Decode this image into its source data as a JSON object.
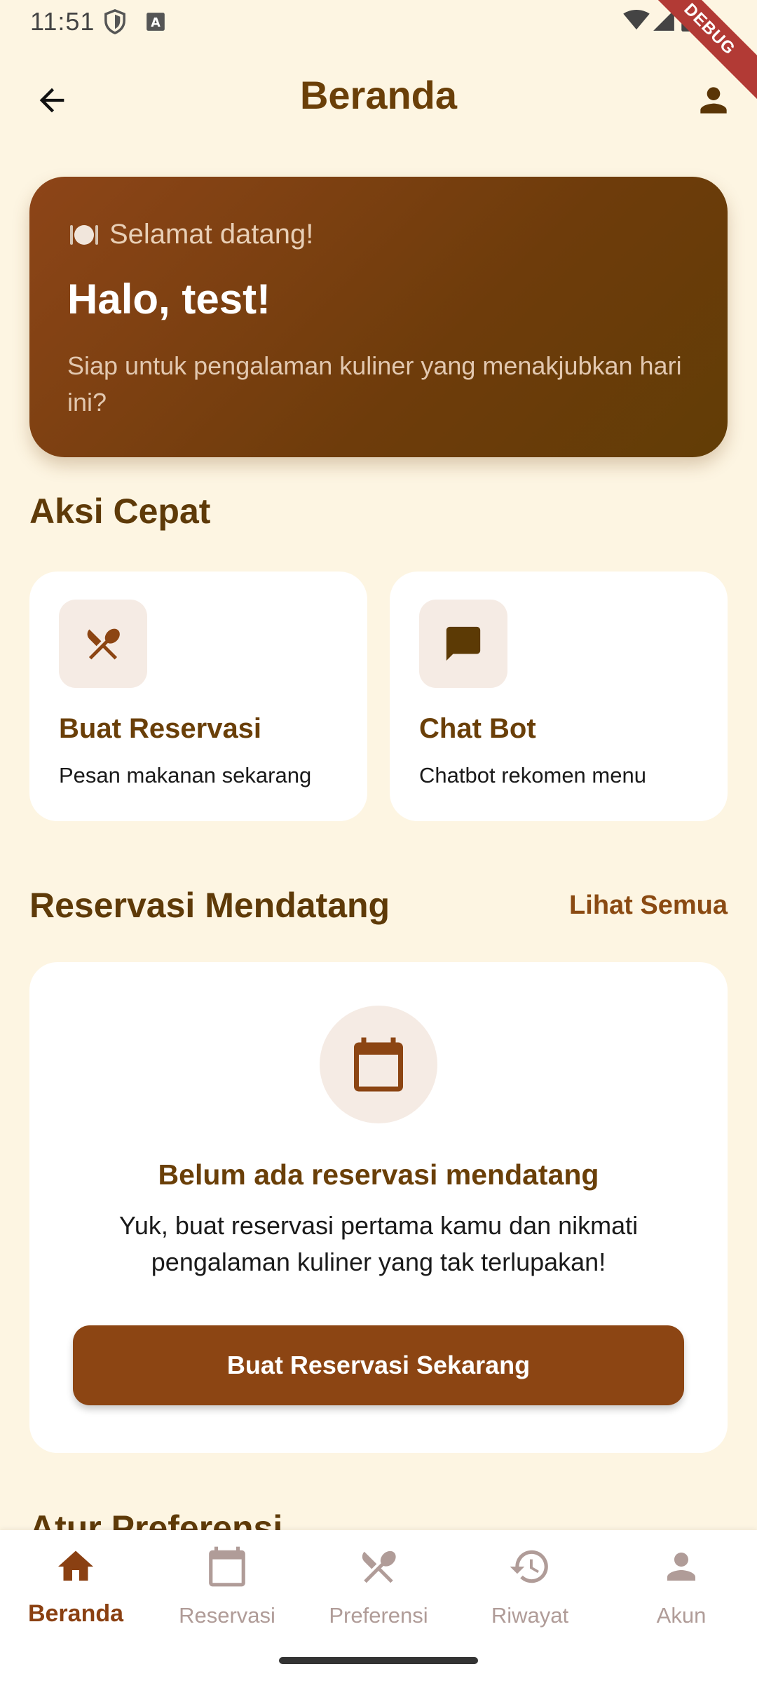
{
  "status_bar": {
    "time": "11:51",
    "debug_label": "DEBUG"
  },
  "app_bar": {
    "title": "Beranda",
    "back_icon": "arrow-back-icon",
    "profile_icon": "person-icon"
  },
  "welcome": {
    "greeting": "Selamat datang!",
    "name": "Halo, test!",
    "subtitle": "Siap untuk pengalaman kuliner yang menakjubkan hari ini?"
  },
  "quick_actions": {
    "title": "Aksi Cepat",
    "items": [
      {
        "title": "Buat Reservasi",
        "desc": "Pesan makanan sekarang",
        "icon": "utensils-icon"
      },
      {
        "title": "Chat Bot",
        "desc": "Chatbot rekomen menu",
        "icon": "chat-icon"
      }
    ]
  },
  "upcoming": {
    "title": "Reservasi Mendatang",
    "see_all": "Lihat Semua",
    "empty_title": "Belum ada reservasi mendatang",
    "empty_desc": "Yuk, buat reservasi pertama kamu dan nikmati pengalaman kuliner yang tak terlupakan!",
    "cta": "Buat Reservasi Sekarang"
  },
  "next_section_peek": "Atur Preferensi",
  "bottom_nav": {
    "active": "Beranda",
    "items": [
      {
        "label": "Beranda",
        "icon": "home-icon"
      },
      {
        "label": "Reservasi",
        "icon": "calendar-icon"
      },
      {
        "label": "Preferensi",
        "icon": "utensils-icon"
      },
      {
        "label": "Riwayat",
        "icon": "history-icon"
      },
      {
        "label": "Akun",
        "icon": "person-icon"
      }
    ]
  },
  "colors": {
    "background": "#fdf5e2",
    "primary": "#8c4513",
    "title_brown": "#6a3f08",
    "card": "#ffffff"
  }
}
